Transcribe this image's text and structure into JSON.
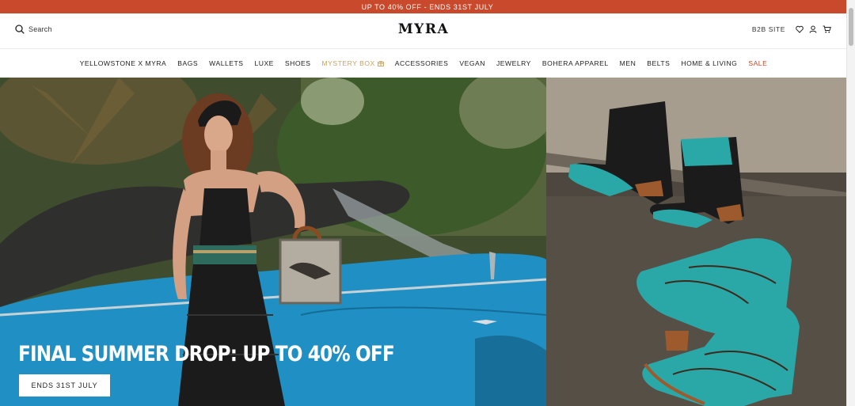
{
  "announcement": {
    "text": "UP TO 40% OFF - ENDS 31ST JULY"
  },
  "header": {
    "search_label": "Search",
    "logo": "MYRA",
    "b2b_label": "B2B SITE"
  },
  "nav": {
    "items": [
      "YELLOWSTONE X MYRA",
      "BAGS",
      "WALLETS",
      "LUXE",
      "SHOES",
      "MYSTERY BOX",
      "ACCESSORIES",
      "VEGAN",
      "JEWELRY",
      "BOHERA APPAREL",
      "MEN",
      "BELTS",
      "HOME & LIVING",
      "SALE"
    ]
  },
  "hero": {
    "title": "FINAL SUMMER DROP: UP TO 40% OFF",
    "button_label": "ENDS 31ST JULY"
  },
  "colors": {
    "announcement_bg": "#c8492c",
    "mystery_box": "#c9a25e",
    "sale": "#c8492c",
    "car_blue": "#1f8fc4",
    "boot_turquoise": "#2aa8a8"
  },
  "icons": [
    "search-icon",
    "gift-icon",
    "heart-icon",
    "user-icon",
    "cart-icon"
  ]
}
